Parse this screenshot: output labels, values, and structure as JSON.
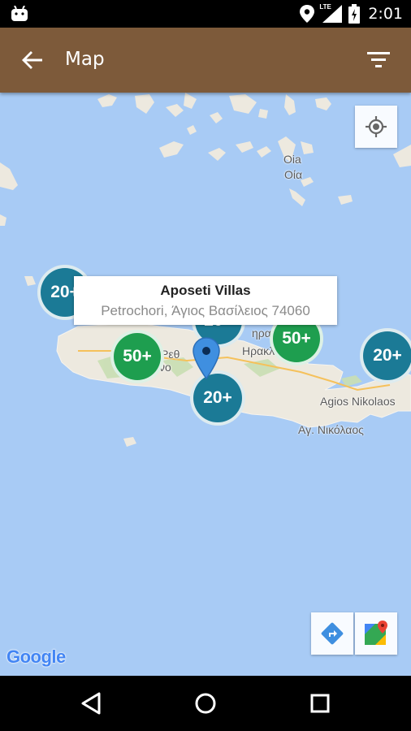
{
  "status_bar": {
    "time": "2:01",
    "network_label": "LTE",
    "icons": [
      "android-icon",
      "location-icon",
      "signal-icon",
      "battery-icon"
    ]
  },
  "app_bar": {
    "title": "Map",
    "background": "#7d5a3a",
    "icons": [
      "back-arrow-icon",
      "filter-icon"
    ]
  },
  "map": {
    "place_labels": {
      "oia_latin": "Oia",
      "oia_greek": "Οία",
      "heraklion_fragment_1": "Ηρακλ",
      "heraklion_fragment_2": "ηρακ",
      "rethymno_fragment_1": "Ρεθ",
      "rethymno_fragment_2": "νο",
      "agios_nikolaos": "Agios Nikolaos",
      "agios_nikolaos_greek": "Αγ. Νικόλαος"
    },
    "clusters": [
      {
        "label": "20+",
        "color": "blue"
      },
      {
        "label": "20+",
        "color": "blue"
      },
      {
        "label": "50+",
        "color": "green"
      },
      {
        "label": "50+",
        "color": "green"
      },
      {
        "label": "20+",
        "color": "blue"
      },
      {
        "label": "20+",
        "color": "blue"
      }
    ],
    "info_window": {
      "title": "Aposeti Villas",
      "address": "Petrochori, Άγιος Βασίλειος 74060"
    },
    "attribution": "Google",
    "colors": {
      "water": "#a8cbf5",
      "land": "#ede9df",
      "cluster_blue": "#1b7a96",
      "cluster_green": "#1e9e4f",
      "pin": "#3f8fe0"
    },
    "buttons": [
      "my-location-icon",
      "directions-icon",
      "google-maps-icon"
    ]
  },
  "nav_bar": {
    "icons": [
      "back-triangle-icon",
      "home-circle-icon",
      "recents-square-icon"
    ]
  }
}
